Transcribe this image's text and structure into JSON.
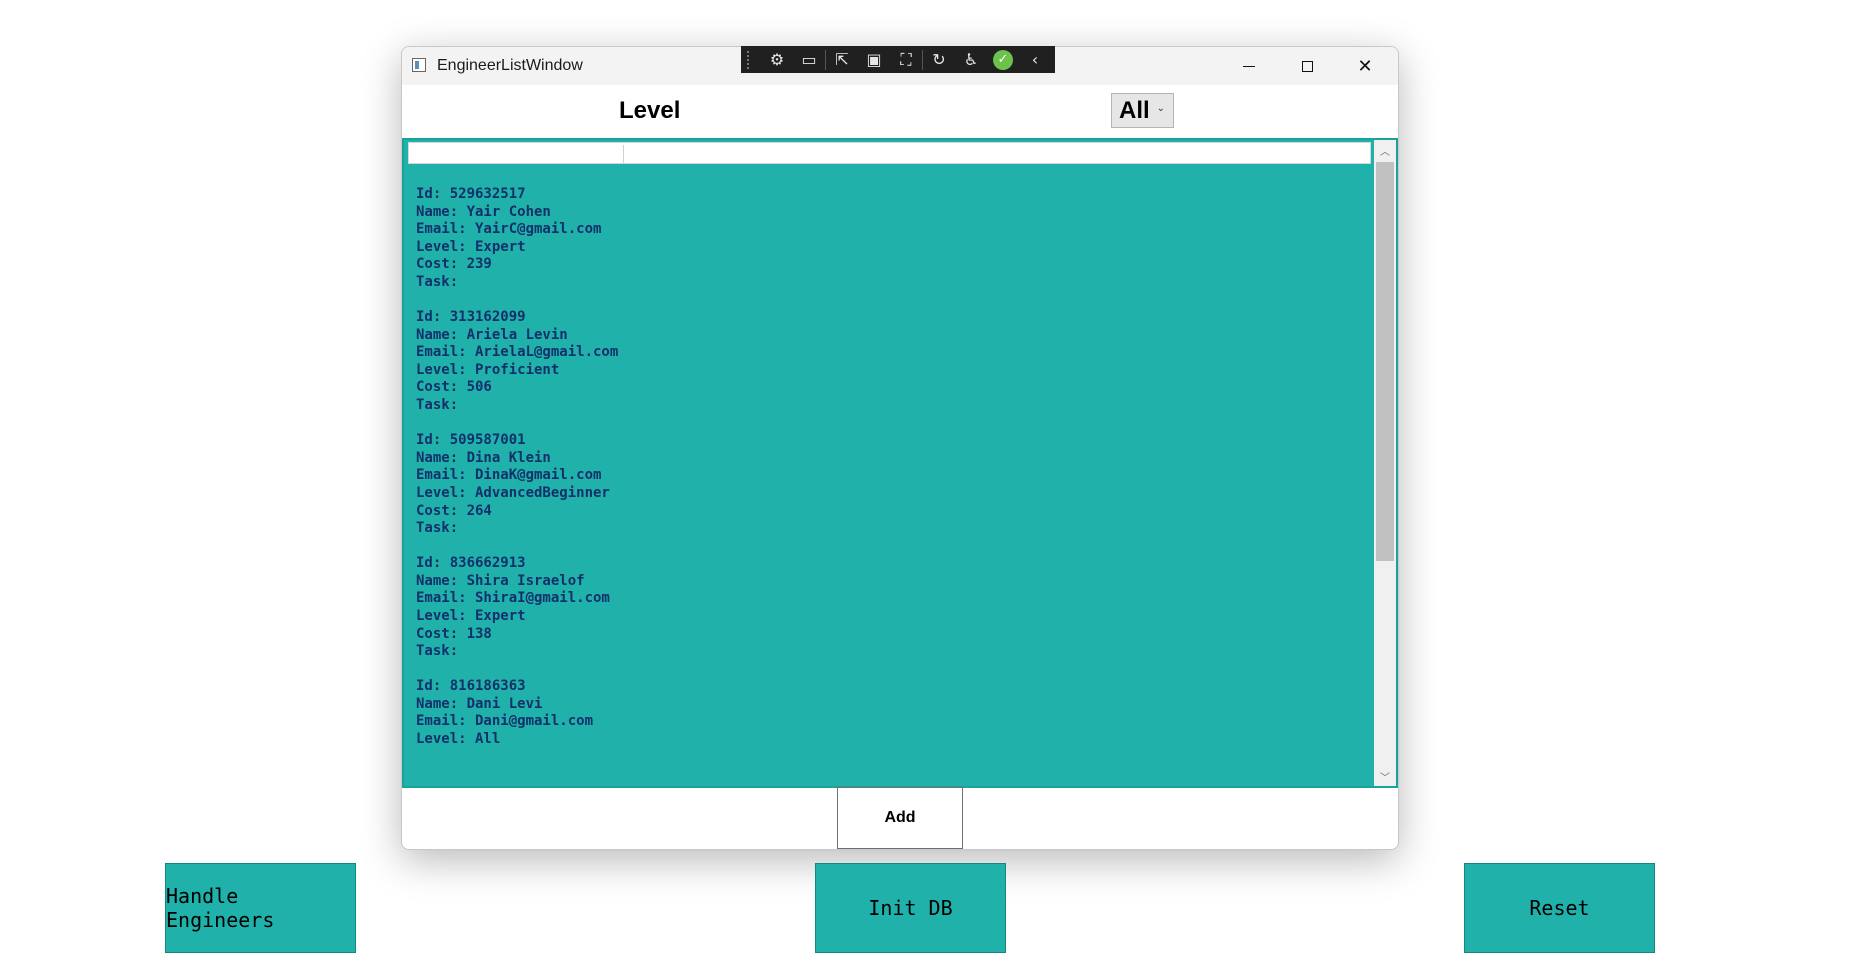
{
  "window": {
    "title": "EngineerListWindow"
  },
  "filter": {
    "label": "Level",
    "selected": "All"
  },
  "engineers": [
    {
      "id": "Id: 529632517",
      "name": "Name: Yair Cohen",
      "email": "Email: YairC@gmail.com",
      "level": "Level: Expert",
      "cost": "Cost: 239",
      "task": "Task:"
    },
    {
      "id": "Id: 313162099",
      "name": "Name: Ariela Levin",
      "email": "Email: ArielaL@gmail.com",
      "level": "Level: Proficient",
      "cost": "Cost: 506",
      "task": "Task:"
    },
    {
      "id": "Id: 509587001",
      "name": "Name: Dina Klein",
      "email": "Email: DinaK@gmail.com",
      "level": "Level: AdvancedBeginner",
      "cost": "Cost: 264",
      "task": "Task:"
    },
    {
      "id": "Id: 836662913",
      "name": "Name: Shira Israelof",
      "email": "Email: ShiraI@gmail.com",
      "level": "Level: Expert",
      "cost": "Cost: 138",
      "task": "Task:"
    },
    {
      "id": "Id: 816186363",
      "name": "Name: Dani Levi",
      "email": "Email: Dani@gmail.com",
      "level": "Level: All",
      "cost": "",
      "task": ""
    }
  ],
  "add_label": "Add",
  "bottom_buttons": {
    "handle": "Handle Engineers",
    "init": "Init DB",
    "reset": "Reset"
  },
  "colors": {
    "list_bg": "#20b2aa",
    "item_text": "#13306b"
  }
}
